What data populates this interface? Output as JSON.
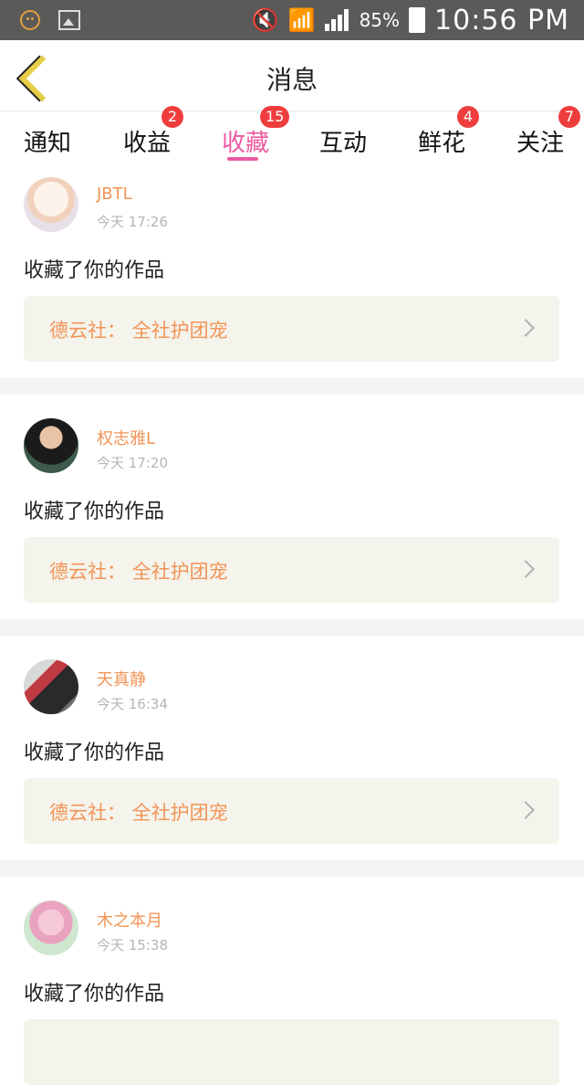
{
  "status_bar": {
    "battery_pct": "85%",
    "time": "10:56 PM"
  },
  "header": {
    "title": "消息"
  },
  "tabs": [
    {
      "label": "通知",
      "badge": null,
      "active": false
    },
    {
      "label": "收益",
      "badge": "2",
      "active": false
    },
    {
      "label": "收藏",
      "badge": "15",
      "active": true
    },
    {
      "label": "互动",
      "badge": null,
      "active": false
    },
    {
      "label": "鲜花",
      "badge": "4",
      "active": false
    },
    {
      "label": "关注",
      "badge": "7",
      "active": false
    }
  ],
  "messages": [
    {
      "username": "JBTL",
      "time": "今天 17:26",
      "action": "收藏了你的作品",
      "work_title": "德云社： 全社护团宠"
    },
    {
      "username": "权志雅L",
      "time": "今天 17:20",
      "action": "收藏了你的作品",
      "work_title": "德云社： 全社护团宠"
    },
    {
      "username": "天真静",
      "time": "今天 16:34",
      "action": "收藏了你的作品",
      "work_title": "德云社： 全社护团宠"
    },
    {
      "username": "木之本月",
      "time": "今天 15:38",
      "action": "收藏了你的作品",
      "work_title": ""
    }
  ],
  "colors": {
    "accent_pink": "#ec5aa0",
    "username_orange": "#f39456",
    "badge_red": "#ef3d3d",
    "back_yellow": "#e7cc4a"
  }
}
